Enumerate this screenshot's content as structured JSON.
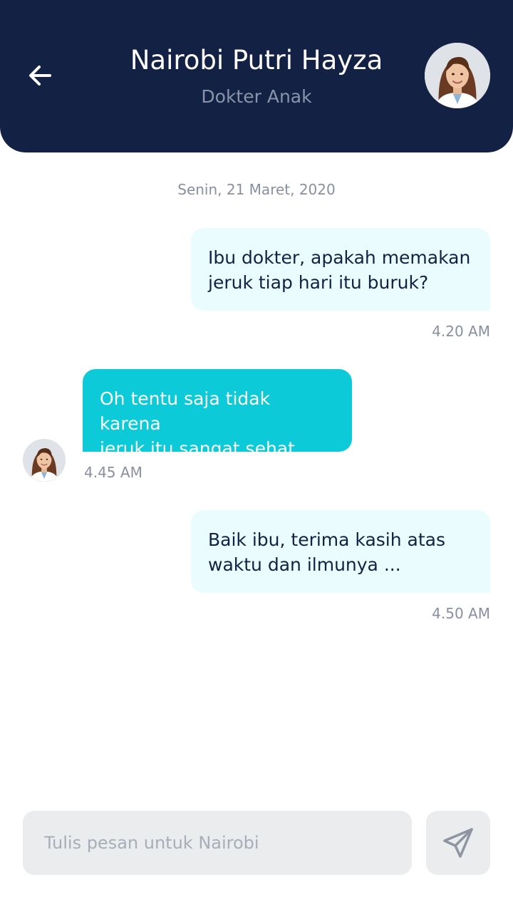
{
  "header": {
    "name": "Nairobi Putri Hayza",
    "role": "Dokter Anak",
    "back_icon": "arrow-left-icon",
    "avatar_icon": "doctor-avatar"
  },
  "chat": {
    "date": "Senin, 21 Maret, 2020",
    "messages": [
      {
        "direction": "outgoing",
        "text": "Ibu dokter, apakah memakan\njeruk tiap hari itu buruk?",
        "time": "4.20 AM"
      },
      {
        "direction": "incoming",
        "text": "Oh tentu saja tidak karena\njeruk itu sangat sehat...",
        "time": "4.45 AM"
      },
      {
        "direction": "outgoing",
        "text": "Baik ibu, terima kasih atas\nwaktu dan ilmunya ...",
        "time": "4.50 AM"
      }
    ]
  },
  "composer": {
    "value": "",
    "placeholder": "Tulis pesan untuk Nairobi",
    "send_icon": "send-icon"
  },
  "colors": {
    "header_bg": "#132244",
    "outgoing_bubble": "#eafcfd",
    "incoming_bubble": "#0ccad7",
    "muted_text": "#8a8fa0",
    "input_bg": "#ebecee"
  }
}
